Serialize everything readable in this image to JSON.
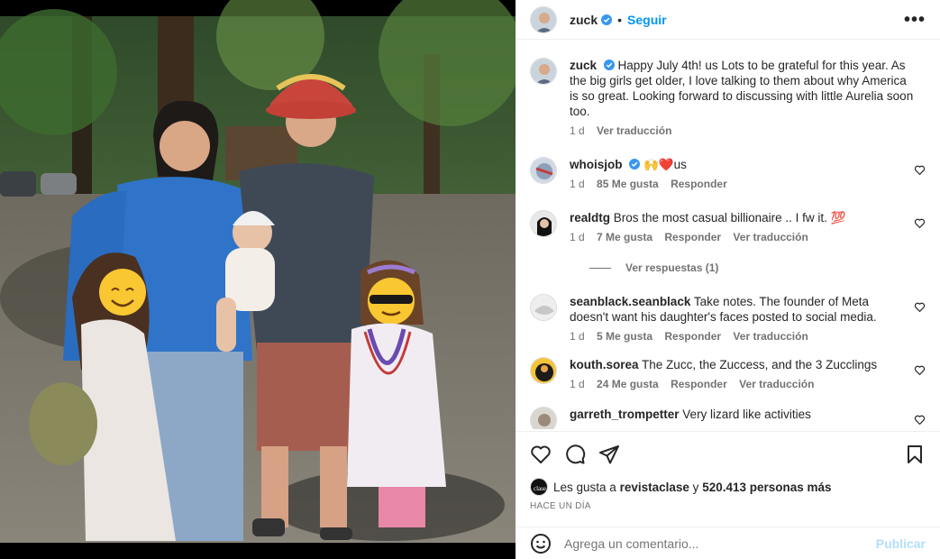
{
  "post": {
    "username": "zuck",
    "follow_label": "Seguir",
    "more_label": "•••"
  },
  "caption": {
    "username": "zuck",
    "text": "Happy July 4th! us Lots to be grateful for this year. As the big girls get older, I love talking to them about why America is so great. Looking forward to discussing with little Aurelia soon too.",
    "time": "1 d",
    "translate": "Ver traducción"
  },
  "comments": [
    {
      "username": "whoisjob",
      "verified": true,
      "text": "🙌❤️us",
      "time": "1 d",
      "likes": "85 Me gusta",
      "reply": "Responder",
      "translate": ""
    },
    {
      "username": "realdtg",
      "verified": false,
      "text": "Bros the most casual billionaire .. I fw it. 💯",
      "time": "1 d",
      "likes": "7 Me gusta",
      "reply": "Responder",
      "translate": "Ver traducción"
    },
    {
      "username": "seanblack.seanblack",
      "verified": false,
      "text": "Take notes. The founder of Meta doesn't want his daughter's faces posted to social media.",
      "time": "1 d",
      "likes": "5 Me gusta",
      "reply": "Responder",
      "translate": "Ver traducción"
    },
    {
      "username": "kouth.sorea",
      "verified": false,
      "text": "The Zucc, the Zuccess, and the 3 Zucclings",
      "time": "1 d",
      "likes": "24 Me gusta",
      "reply": "Responder",
      "translate": "Ver traducción"
    },
    {
      "username": "garreth_trompetter",
      "verified": false,
      "text": "Very lizard like activities",
      "time": "",
      "likes": "",
      "reply": "",
      "translate": ""
    }
  ],
  "replies_label": "Ver respuestas (1)",
  "likes": {
    "prefix": "Les gusta a",
    "user": "revistaclase",
    "connector": "y",
    "others": "520.413 personas más"
  },
  "posted_ago": "HACE UN DÍA",
  "comment_input": {
    "placeholder": "Agrega un comentario...",
    "post_label": "Publicar"
  },
  "colors": {
    "link_blue": "#0095f6",
    "muted": "#737373",
    "verified_blue": "#3897f0"
  },
  "icons": [
    "heart-icon",
    "comment-icon",
    "share-icon",
    "bookmark-icon",
    "emoji-icon",
    "verified-icon",
    "more-icon"
  ]
}
